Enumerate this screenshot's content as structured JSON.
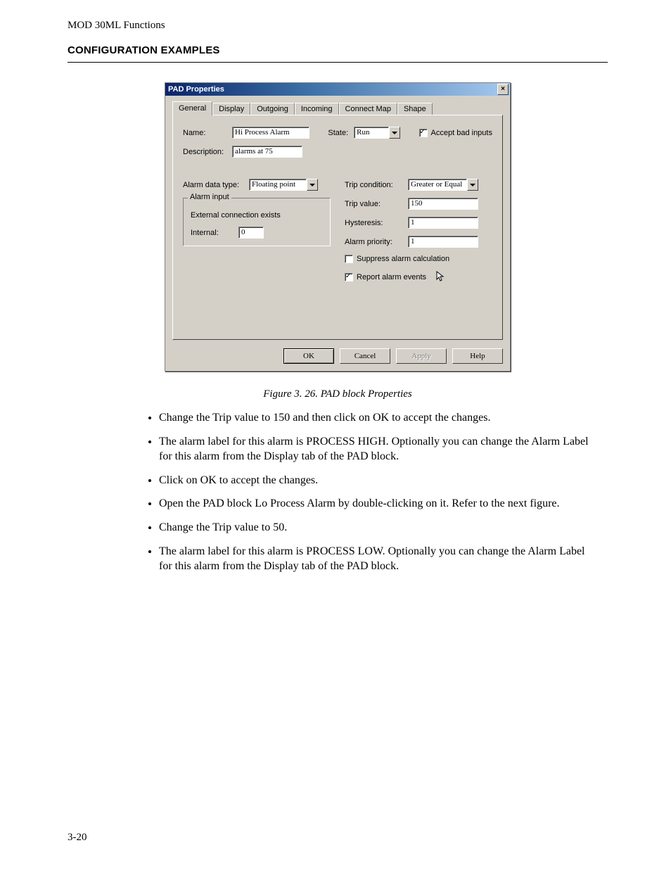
{
  "page": {
    "running_head": "MOD 30ML Functions",
    "section_title": "CONFIGURATION EXAMPLES",
    "number": "3-20"
  },
  "dialog": {
    "title": "PAD Properties",
    "tabs": [
      "General",
      "Display",
      "Outgoing",
      "Incoming",
      "Connect Map",
      "Shape"
    ],
    "active_tab": "General",
    "labels": {
      "name": "Name:",
      "description": "Description:",
      "state": "State:",
      "accept_bad": "Accept bad inputs",
      "alarm_data_type": "Alarm data type:",
      "alarm_input_group": "Alarm input",
      "external": "External connection exists",
      "internal": "Internal:",
      "trip_condition": "Trip condition:",
      "trip_value": "Trip value:",
      "hysteresis": "Hysteresis:",
      "alarm_priority": "Alarm priority:",
      "suppress": "Suppress alarm calculation",
      "report": "Report alarm events"
    },
    "values": {
      "name": "Hi Process Alarm",
      "description": "alarms at 75",
      "state": "Run",
      "accept_bad_checked": true,
      "alarm_data_type": "Floating point",
      "internal": "0",
      "trip_condition": "Greater or Equal",
      "trip_value": "150",
      "hysteresis": "1",
      "alarm_priority": "1",
      "suppress_checked": false,
      "report_checked": true
    },
    "buttons": {
      "ok": "OK",
      "cancel": "Cancel",
      "apply": "Apply",
      "help": "Help"
    }
  },
  "caption": {
    "prefix": "Figure 3. 26. ",
    "text": "PAD block Properties"
  },
  "bullets": [
    "Change the Trip value to 150 and then click on OK to accept the changes.",
    "The alarm label for this alarm is PROCESS HIGH. Optionally you can change the Alarm Label for this alarm from the Display tab of the PAD block.",
    "Click on OK to accept the changes.",
    "Open the PAD block Lo Process Alarm by double-clicking on it. Refer to the next figure.",
    "Change the Trip value to 50.",
    "The alarm label for this alarm is PROCESS LOW. Optionally you can change the Alarm Label for this alarm from the Display tab of the PAD block."
  ]
}
